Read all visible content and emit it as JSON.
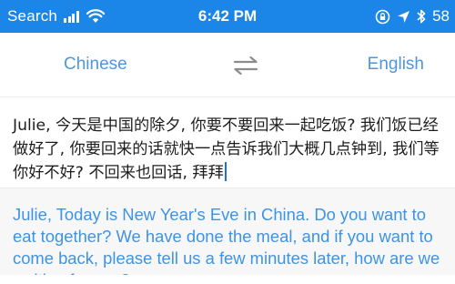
{
  "status_bar": {
    "carrier": "Search",
    "time": "6:42 PM",
    "battery": "58",
    "background_color": "#1b85e8",
    "icons": [
      "signal-icon",
      "wifi-icon",
      "screen-lock-icon",
      "location-icon",
      "bluetooth-icon"
    ]
  },
  "language_bar": {
    "source_language": "Chinese",
    "target_language": "English",
    "swap_icon": "swap-arrows-icon",
    "accent_color": "#4d96e0"
  },
  "source": {
    "text": "Julie, 今天是中国的除夕, 你要不要回来一起吃饭? 我们饭已经做好了, 你要回来的话就快一点告诉我们大概几点钟到, 我们等你好不好? 不回来也回话, 拜拜"
  },
  "translation": {
    "text": "Julie, Today is New Year's Eve in China. Do you want to eat together? We have done the meal, and if you want to come back, please tell us a few minutes later, how are we waiting for you?",
    "text_color": "#3f93e3"
  }
}
